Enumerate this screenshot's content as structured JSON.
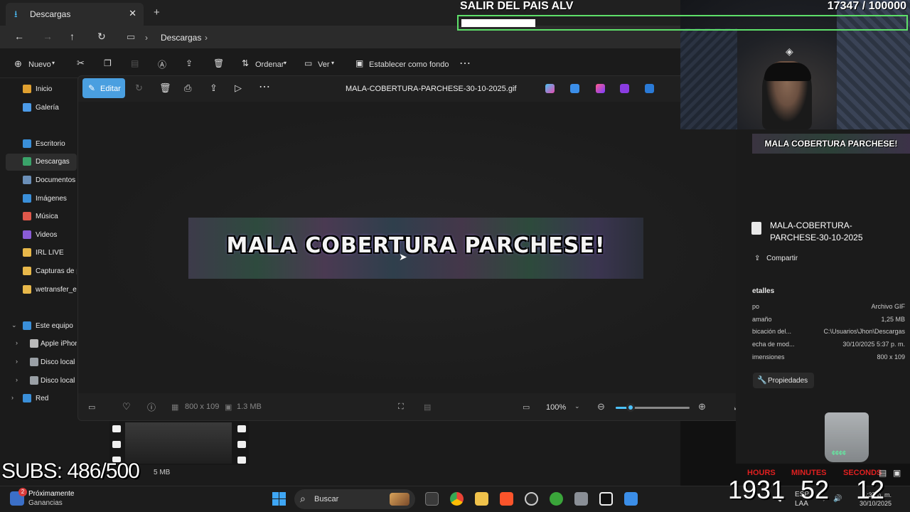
{
  "explorer": {
    "tab_title": "Descargas",
    "breadcrumb": "Descargas",
    "toolbar": {
      "new_label": "Nuevo",
      "sort_label": "Ordenar",
      "view_label": "Ver",
      "set_background_label": "Establecer como fondo"
    },
    "sidebar": [
      {
        "label": "Inicio",
        "icon": "home-icon",
        "color": "#e0a030"
      },
      {
        "label": "Galería",
        "icon": "gallery-icon",
        "color": "#4c9be8"
      },
      {
        "label": "Escritorio",
        "icon": "desktop-icon",
        "color": "#3a8fd9"
      },
      {
        "label": "Descargas",
        "icon": "download-icon",
        "color": "#3aa36a",
        "selected": true
      },
      {
        "label": "Documentos",
        "icon": "documents-icon",
        "color": "#6b8fb8"
      },
      {
        "label": "Imágenes",
        "icon": "pictures-icon",
        "color": "#3a8fd9"
      },
      {
        "label": "Música",
        "icon": "music-icon",
        "color": "#e0584b"
      },
      {
        "label": "Videos",
        "icon": "videos-icon",
        "color": "#8a5cd6"
      },
      {
        "label": "IRL LIVE",
        "icon": "folder-icon",
        "color": "#e8b84a"
      },
      {
        "label": "Capturas de pa",
        "icon": "folder-icon",
        "color": "#e8b84a"
      },
      {
        "label": "wetransfer_el-",
        "icon": "folder-icon",
        "color": "#e8b84a"
      },
      {
        "label": "Este equipo",
        "icon": "pc-icon",
        "color": "#3a8fd9",
        "expanded": true
      },
      {
        "label": "Apple iPhon",
        "icon": "phone-icon",
        "color": "#bbbbbb"
      },
      {
        "label": "Disco local (",
        "icon": "drive-icon",
        "color": "#9aa0a6"
      },
      {
        "label": "Disco local (I",
        "icon": "drive-icon",
        "color": "#9aa0a6"
      },
      {
        "label": "Red",
        "icon": "network-icon",
        "color": "#3a8fd9"
      }
    ],
    "status_fragment": "5 MB"
  },
  "viewer": {
    "edit_label": "Editar",
    "file_name": "MALA-COBERTURA-PARCHESE-30-10-2025.gif",
    "image_text": "MALA COBERTURA PARCHESE!",
    "dimensions": "800 x 109",
    "size": "1.3 MB",
    "zoom": "100%",
    "zoom_level": 0.2
  },
  "details": {
    "banner_text": "MALA COBERTURA PARCHESE!",
    "file_name": "MALA-COBERTURA-PARCHESE-30-10-2025",
    "share_label": "Compartir",
    "section_title": "etalles",
    "rows": [
      {
        "k": "po",
        "v": "Archivo GIF"
      },
      {
        "k": "amaño",
        "v": "1,25 MB"
      },
      {
        "k": "bicación del...",
        "v": "C:\\Usuarios\\Jhon\\Descargas"
      },
      {
        "k": "echa de mod...",
        "v": "30/10/2025 5:37 p. m."
      },
      {
        "k": "imensiones",
        "v": "800 x 109"
      }
    ],
    "properties_label": "Propiedades"
  },
  "overlay": {
    "goal_title": "SALIR DEL PAIS ALV",
    "goal_count": "17347  / 100000",
    "goal_progress": 0.17347,
    "subs_text": "SUBS: 486/500",
    "cup_text": "¢¢¢¢",
    "timer": {
      "hours_label": "HOURS",
      "minutes_label": "MINUTES",
      "seconds_label": "SECONDS",
      "hours": "1931",
      "minutes": "52",
      "seconds": "12"
    }
  },
  "taskbar": {
    "weather_title": "Próximamente",
    "weather_sub": "Ganancias",
    "notification_count": "2",
    "search_label": "Buscar",
    "tray_lang": "ESP",
    "tray_sub": "LAA",
    "clock_time": "5:37 p. m.",
    "clock_date": "30/10/2025"
  }
}
